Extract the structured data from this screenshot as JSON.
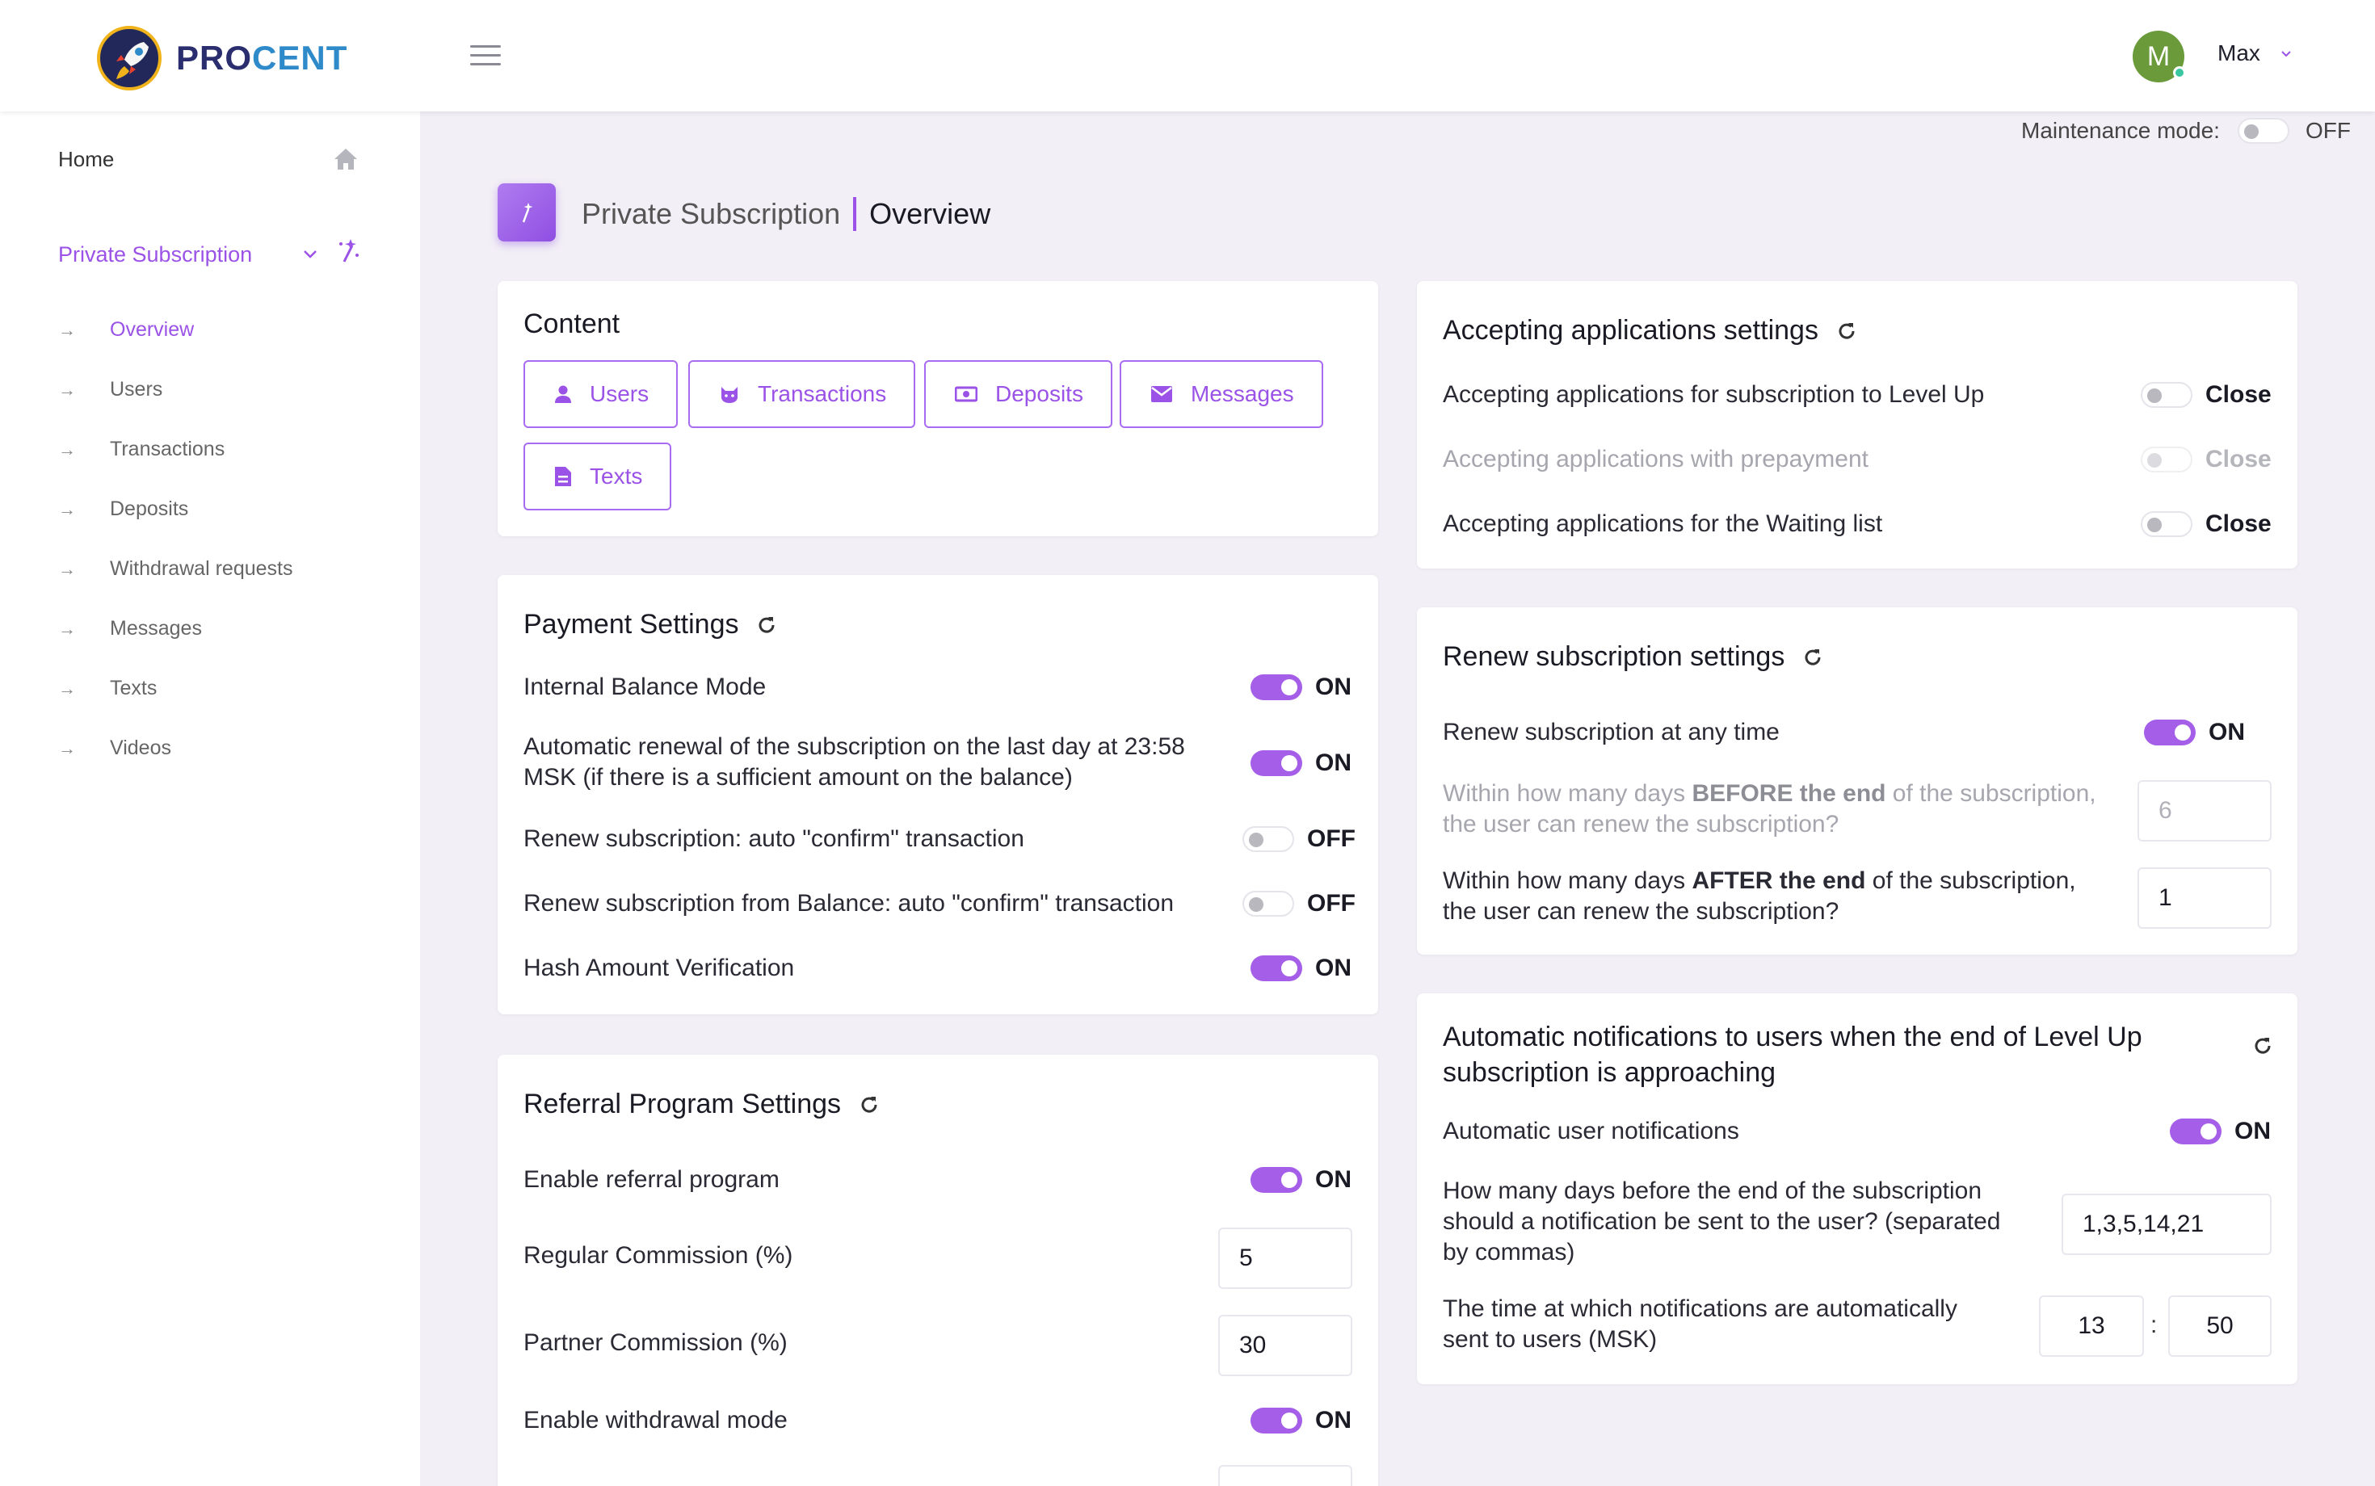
{
  "header": {
    "logo_a": "PRO",
    "logo_b": "CENT",
    "user_initial": "M",
    "user_name": "Max"
  },
  "sidebar": {
    "home": "Home",
    "section": "Private Subscription",
    "items": [
      {
        "label": "Overview"
      },
      {
        "label": "Users"
      },
      {
        "label": "Transactions"
      },
      {
        "label": "Deposits"
      },
      {
        "label": "Withdrawal requests"
      },
      {
        "label": "Messages"
      },
      {
        "label": "Texts"
      },
      {
        "label": "Videos"
      }
    ]
  },
  "maintenance": {
    "label": "Maintenance mode:",
    "state": "OFF"
  },
  "page_title": {
    "section": "Private Subscription",
    "current": "Overview"
  },
  "content": {
    "title": "Content",
    "buttons": [
      "Users",
      "Transactions",
      "Deposits",
      "Messages",
      "Texts"
    ]
  },
  "payment": {
    "title": "Payment Settings",
    "rows": [
      {
        "label": "Internal Balance Mode",
        "state": "ON"
      },
      {
        "label_line1": "Automatic renewal of the subscription on the last day at 23:58",
        "label_line2": "MSK (if there is a sufficient amount on the balance)",
        "state": "ON"
      },
      {
        "label": "Renew subscription: auto \"confirm\" transaction",
        "state": "OFF"
      },
      {
        "label": "Renew subscription from Balance: auto \"confirm\" transaction",
        "state": "OFF"
      },
      {
        "label": "Hash Amount Verification",
        "state": "ON"
      }
    ]
  },
  "referral": {
    "title": "Referral Program Settings",
    "enable_label": "Enable referral program",
    "enable_state": "ON",
    "regular_label": "Regular Commission (%)",
    "regular_value": "5",
    "partner_label": "Partner Commission (%)",
    "partner_value": "30",
    "withdrawal_label": "Enable withdrawal mode",
    "withdrawal_state": "ON"
  },
  "accepting": {
    "title": "Accepting applications settings",
    "rows": [
      {
        "label": "Accepting applications for subscription to Level Up",
        "state": "Close"
      },
      {
        "label": "Accepting applications with prepayment",
        "state": "Close"
      },
      {
        "label": "Accepting applications for the Waiting list",
        "state": "Close"
      }
    ]
  },
  "renew": {
    "title": "Renew subscription settings",
    "anytime_label": "Renew subscription at any time",
    "anytime_state": "ON",
    "before_pre": "Within how many days ",
    "before_bold": "BEFORE the end",
    "before_post": " of the subscription,",
    "before_line2": "the user can renew the subscription?",
    "before_value": "6",
    "after_pre": "Within how many days ",
    "after_bold": "AFTER the end",
    "after_post": " of the subscription,",
    "after_line2": "the user can renew the subscription?",
    "after_value": "1"
  },
  "notifications": {
    "title_line1": "Automatic notifications to users when the end of Level Up",
    "title_line2": "subscription is approaching",
    "auto_label": "Automatic user notifications",
    "auto_state": "ON",
    "days_line1": "How many days before the end of the subscription",
    "days_line2": "should a notification be sent to the user? (separated",
    "days_line3": "by commas)",
    "days_value": "1,3,5,14,21",
    "time_line1": "The time at which notifications are automatically",
    "time_line2": "sent to users (MSK)",
    "time_hour": "13",
    "time_sep": ":",
    "time_min": "50"
  },
  "colors": {
    "accent": "#9b52e6",
    "background": "#f2eff6"
  }
}
